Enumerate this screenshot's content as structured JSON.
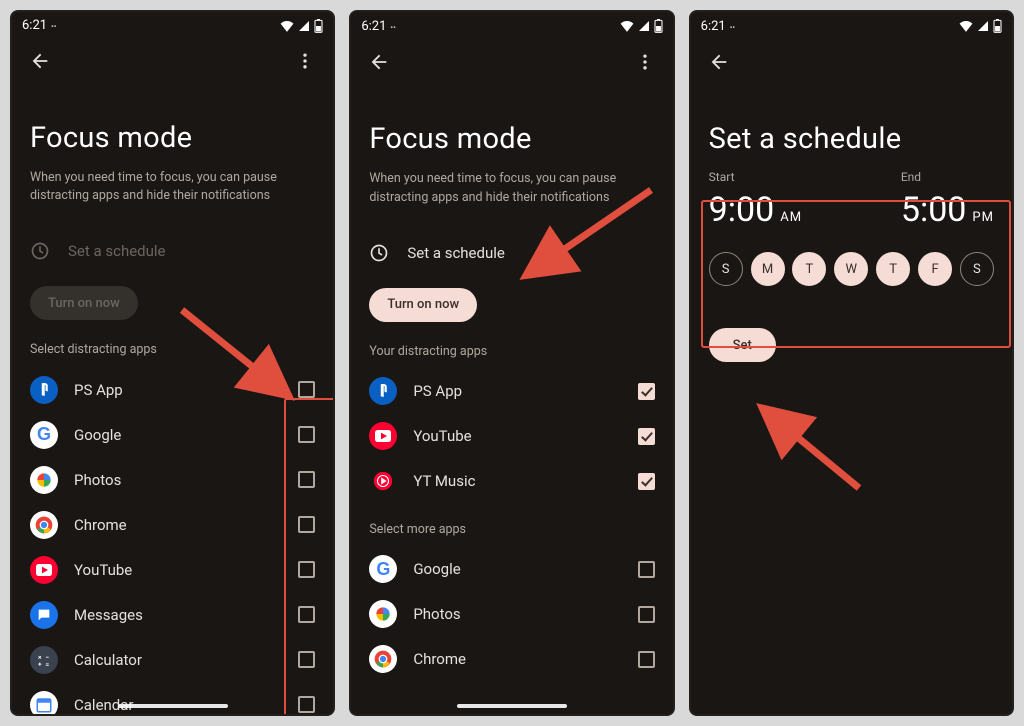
{
  "status": {
    "time": "6:21"
  },
  "screen1": {
    "title": "Focus mode",
    "subtitle": "When you need time to focus, you can pause distracting apps and hide their notifications",
    "schedule_label": "Set a schedule",
    "turn_on": "Turn on now",
    "section": "Select distracting apps",
    "apps": [
      {
        "name": "PS App",
        "icon": "ps",
        "bg": "#0a5fc2"
      },
      {
        "name": "Google",
        "icon": "google",
        "bg": "#ffffff"
      },
      {
        "name": "Photos",
        "icon": "photos",
        "bg": "#ffffff"
      },
      {
        "name": "Chrome",
        "icon": "chrome",
        "bg": "#ffffff"
      },
      {
        "name": "YouTube",
        "icon": "youtube",
        "bg": "#ff0033"
      },
      {
        "name": "Messages",
        "icon": "messages",
        "bg": "#1a73e8"
      },
      {
        "name": "Calculator",
        "icon": "calculator",
        "bg": "#3a4250"
      },
      {
        "name": "Calendar",
        "icon": "calendar",
        "bg": "#ffffff"
      }
    ]
  },
  "screen2": {
    "title": "Focus mode",
    "subtitle": "When you need time to focus, you can pause distracting apps and hide their notifications",
    "schedule_label": "Set a schedule",
    "turn_on": "Turn on now",
    "section_selected": "Your distracting apps",
    "section_more": "Select more apps",
    "selected_apps": [
      {
        "name": "PS App",
        "icon": "ps",
        "bg": "#0a5fc2"
      },
      {
        "name": "YouTube",
        "icon": "youtube",
        "bg": "#ff0033"
      },
      {
        "name": "YT Music",
        "icon": "ytmusic",
        "bg": "#ff0033"
      }
    ],
    "more_apps": [
      {
        "name": "Google",
        "icon": "google",
        "bg": "#ffffff"
      },
      {
        "name": "Photos",
        "icon": "photos",
        "bg": "#ffffff"
      },
      {
        "name": "Chrome",
        "icon": "chrome",
        "bg": "#ffffff"
      }
    ]
  },
  "screen3": {
    "title": "Set a schedule",
    "start_label": "Start",
    "end_label": "End",
    "start_time": "9:00",
    "start_ampm": "AM",
    "end_time": "5:00",
    "end_ampm": "PM",
    "days": [
      {
        "d": "S",
        "sel": false
      },
      {
        "d": "M",
        "sel": true
      },
      {
        "d": "T",
        "sel": true
      },
      {
        "d": "W",
        "sel": true
      },
      {
        "d": "T",
        "sel": true
      },
      {
        "d": "F",
        "sel": true
      },
      {
        "d": "S",
        "sel": false
      }
    ],
    "set": "Set"
  }
}
